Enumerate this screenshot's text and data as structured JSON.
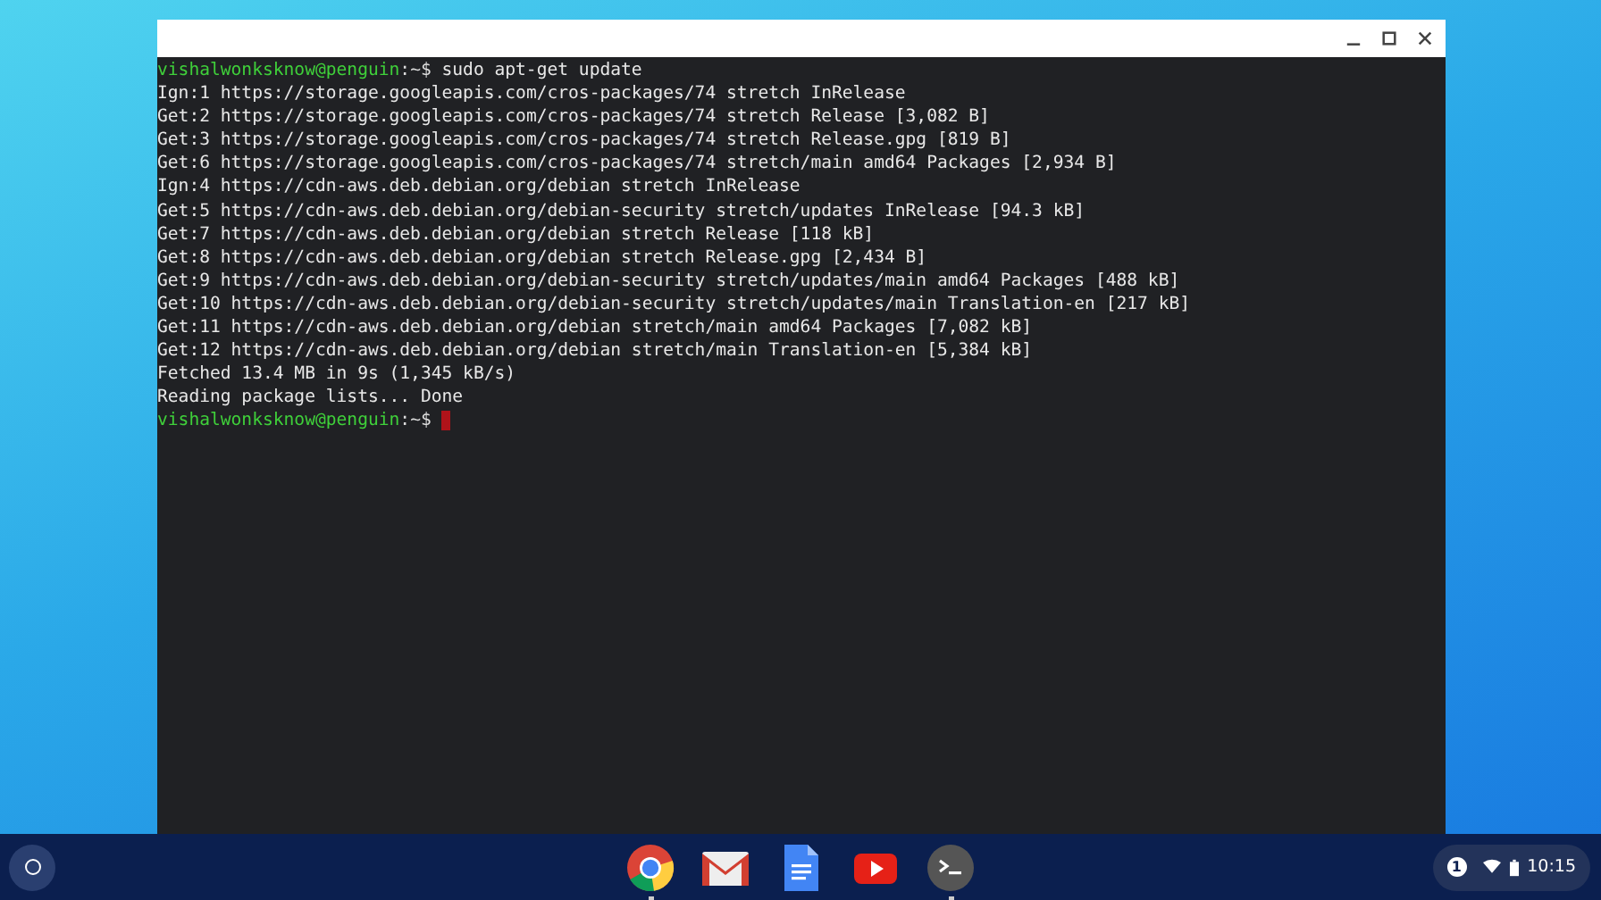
{
  "terminal": {
    "lines": [
      {
        "kind": "prompt",
        "user": "vishalwonksknow@penguin",
        "path": ":~$",
        "command": "sudo apt-get update",
        "cursor": false
      },
      {
        "kind": "output",
        "text": "Ign:1 https://storage.googleapis.com/cros-packages/74 stretch InRelease"
      },
      {
        "kind": "output",
        "text": "Get:2 https://storage.googleapis.com/cros-packages/74 stretch Release [3,082 B]"
      },
      {
        "kind": "output",
        "text": "Get:3 https://storage.googleapis.com/cros-packages/74 stretch Release.gpg [819 B]"
      },
      {
        "kind": "output",
        "text": "Get:6 https://storage.googleapis.com/cros-packages/74 stretch/main amd64 Packages [2,934 B]"
      },
      {
        "kind": "output",
        "text": "Ign:4 https://cdn-aws.deb.debian.org/debian stretch InRelease"
      },
      {
        "kind": "output",
        "text": "Get:5 https://cdn-aws.deb.debian.org/debian-security stretch/updates InRelease [94.3 kB]"
      },
      {
        "kind": "output",
        "text": "Get:7 https://cdn-aws.deb.debian.org/debian stretch Release [118 kB]"
      },
      {
        "kind": "output",
        "text": "Get:8 https://cdn-aws.deb.debian.org/debian stretch Release.gpg [2,434 B]"
      },
      {
        "kind": "output",
        "text": "Get:9 https://cdn-aws.deb.debian.org/debian-security stretch/updates/main amd64 Packages [488 kB]"
      },
      {
        "kind": "output",
        "text": "Get:10 https://cdn-aws.deb.debian.org/debian-security stretch/updates/main Translation-en [217 kB]"
      },
      {
        "kind": "output",
        "text": "Get:11 https://cdn-aws.deb.debian.org/debian stretch/main amd64 Packages [7,082 kB]"
      },
      {
        "kind": "output",
        "text": "Get:12 https://cdn-aws.deb.debian.org/debian stretch/main Translation-en [5,384 kB]"
      },
      {
        "kind": "output",
        "text": "Fetched 13.4 MB in 9s (1,345 kB/s)"
      },
      {
        "kind": "output",
        "text": "Reading package lists... Done"
      },
      {
        "kind": "prompt",
        "user": "vishalwonksknow@penguin",
        "path": ":~$",
        "cursor": true
      }
    ]
  },
  "shelf": {
    "apps": [
      {
        "kind": "chrome",
        "running": true
      },
      {
        "kind": "gmail",
        "running": false
      },
      {
        "kind": "docs",
        "running": false
      },
      {
        "kind": "youtube",
        "running": false
      },
      {
        "kind": "terminal",
        "running": true
      }
    ],
    "tray": {
      "notifications": "1",
      "time": "10:15"
    }
  }
}
